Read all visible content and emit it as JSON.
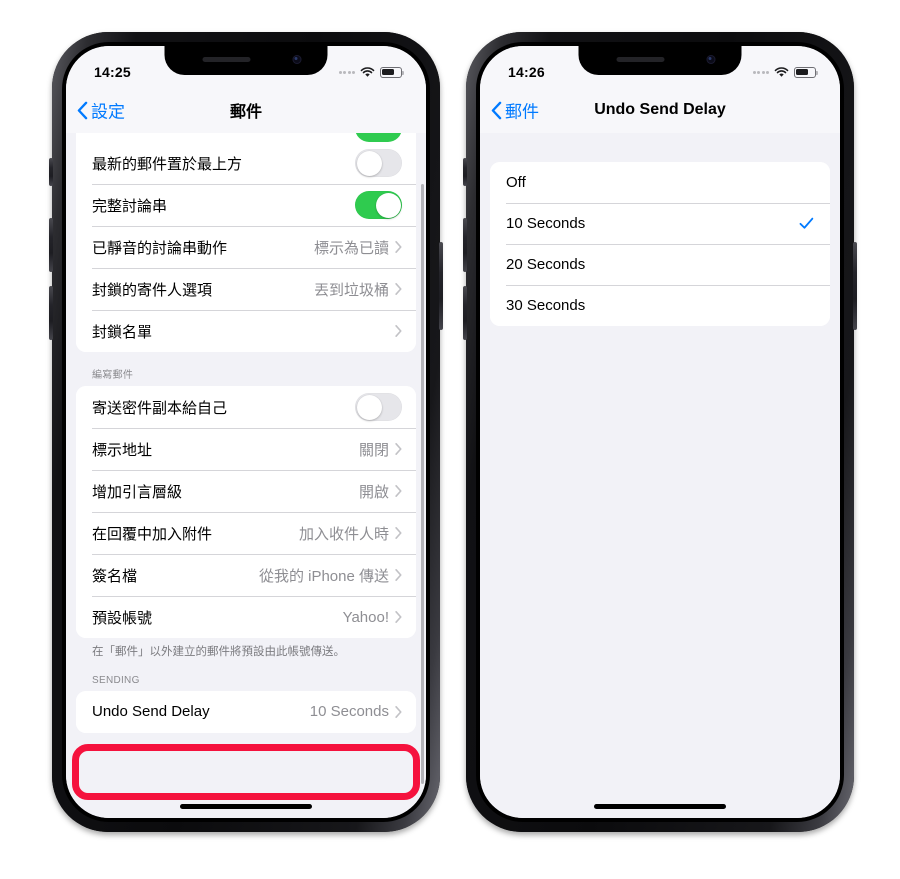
{
  "phones": {
    "left": {
      "status": {
        "time": "14:25",
        "wifi_icon": "wifi-icon",
        "battery_icon": "battery-icon",
        "signal_icon": "signal-dots-icon"
      },
      "nav": {
        "back_label": "設定",
        "back_icon": "chevron-left-icon",
        "title": "郵件"
      },
      "groups": [
        {
          "header": "",
          "footer": "",
          "rows": [
            {
              "label": "最新的郵件置於最上方",
              "type": "toggle",
              "value": "off"
            },
            {
              "label": "完整討論串",
              "type": "toggle",
              "value": "on"
            },
            {
              "label": "已靜音的討論串動作",
              "type": "disclosure",
              "value": "標示為已讀"
            },
            {
              "label": "封鎖的寄件人選項",
              "type": "disclosure",
              "value": "丟到垃圾桶"
            },
            {
              "label": "封鎖名單",
              "type": "disclosure",
              "value": ""
            }
          ]
        },
        {
          "header": "編寫郵件",
          "footer": "在「郵件」以外建立的郵件將預設由此帳號傳送。",
          "rows": [
            {
              "label": "寄送密件副本給自己",
              "type": "toggle",
              "value": "off"
            },
            {
              "label": "標示地址",
              "type": "disclosure",
              "value": "關閉"
            },
            {
              "label": "增加引言層級",
              "type": "disclosure",
              "value": "開啟"
            },
            {
              "label": "在回覆中加入附件",
              "type": "disclosure",
              "value": "加入收件人時"
            },
            {
              "label": "簽名檔",
              "type": "disclosure",
              "value": "從我的 iPhone 傳送"
            },
            {
              "label": "預設帳號",
              "type": "disclosure",
              "value": "Yahoo!"
            }
          ]
        },
        {
          "header": "SENDING",
          "footer": "",
          "highlighted": true,
          "rows": [
            {
              "label": "Undo Send Delay",
              "type": "disclosure",
              "value": "10 Seconds"
            }
          ]
        }
      ]
    },
    "right": {
      "status": {
        "time": "14:26",
        "wifi_icon": "wifi-icon",
        "battery_icon": "battery-icon",
        "signal_icon": "signal-dots-icon"
      },
      "nav": {
        "back_label": "郵件",
        "back_icon": "chevron-left-icon",
        "title": "Undo Send Delay"
      },
      "options": [
        {
          "label": "Off",
          "selected": false
        },
        {
          "label": "10 Seconds",
          "selected": true
        },
        {
          "label": "20 Seconds",
          "selected": false
        },
        {
          "label": "30 Seconds",
          "selected": false
        }
      ]
    }
  },
  "colors": {
    "accent_blue": "#007AFF",
    "toggle_green": "#2FCB4F",
    "highlight_red": "#F5123D",
    "value_gray": "#8E8E93",
    "screen_bg": "#F2F2F7"
  }
}
